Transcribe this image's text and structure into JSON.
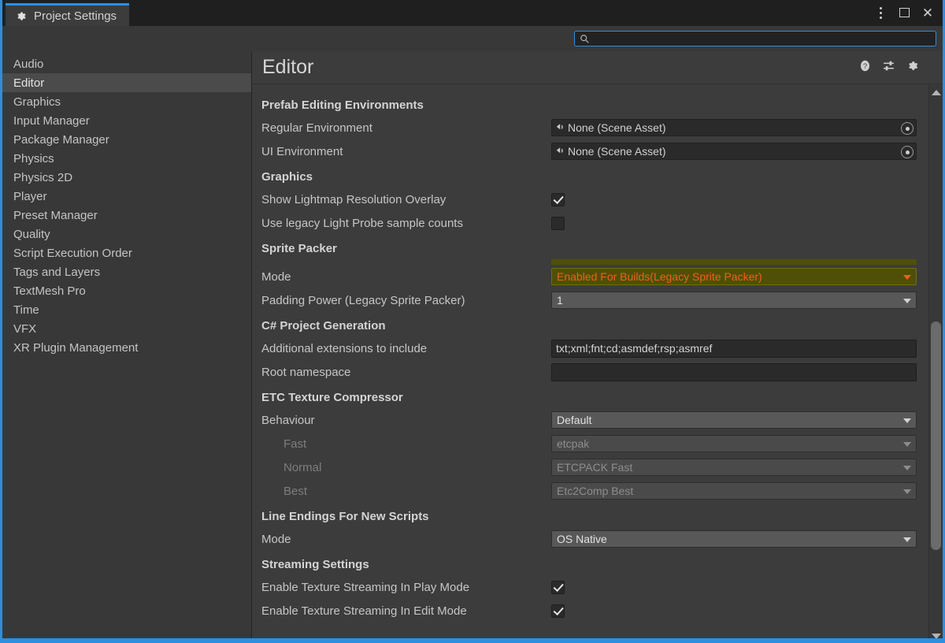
{
  "window": {
    "tab_title": "Project Settings",
    "tab_icon": "gear-icon",
    "controls": {
      "menu": "kebab-menu-icon",
      "maximize": "maximize-icon",
      "close": "close-icon"
    },
    "accent_color": "#2c8fe0"
  },
  "search": {
    "value": "",
    "placeholder": "",
    "icon": "search-icon"
  },
  "sidebar": {
    "items": [
      {
        "label": "Audio",
        "selected": false
      },
      {
        "label": "Editor",
        "selected": true
      },
      {
        "label": "Graphics",
        "selected": false
      },
      {
        "label": "Input Manager",
        "selected": false
      },
      {
        "label": "Package Manager",
        "selected": false
      },
      {
        "label": "Physics",
        "selected": false
      },
      {
        "label": "Physics 2D",
        "selected": false
      },
      {
        "label": "Player",
        "selected": false
      },
      {
        "label": "Preset Manager",
        "selected": false
      },
      {
        "label": "Quality",
        "selected": false
      },
      {
        "label": "Script Execution Order",
        "selected": false
      },
      {
        "label": "Tags and Layers",
        "selected": false
      },
      {
        "label": "TextMesh Pro",
        "selected": false
      },
      {
        "label": "Time",
        "selected": false
      },
      {
        "label": "VFX",
        "selected": false
      },
      {
        "label": "XR Plugin Management",
        "selected": false
      }
    ]
  },
  "panel": {
    "title": "Editor",
    "icons": [
      {
        "name": "help-icon"
      },
      {
        "name": "preset-icon"
      },
      {
        "name": "gear-icon"
      }
    ],
    "sections": [
      {
        "header": "Prefab Editing Environments",
        "rows": [
          {
            "label": "Regular Environment",
            "type": "object",
            "value": "None (Scene Asset)"
          },
          {
            "label": "UI Environment",
            "type": "object",
            "value": "None (Scene Asset)"
          }
        ]
      },
      {
        "header": "Graphics",
        "rows": [
          {
            "label": "Show Lightmap Resolution Overlay",
            "type": "checkbox",
            "checked": true
          },
          {
            "label": "Use legacy Light Probe sample counts",
            "type": "checkbox",
            "checked": false
          }
        ]
      },
      {
        "header": "Sprite Packer",
        "rows": [
          {
            "label": "Mode",
            "type": "dropdown",
            "value": "Enabled For Builds(Legacy Sprite Packer)",
            "highlight": true
          },
          {
            "label": "Padding Power (Legacy Sprite Packer)",
            "type": "dropdown",
            "value": "1"
          }
        ]
      },
      {
        "header": "C# Project Generation",
        "rows": [
          {
            "label": "Additional extensions to include",
            "type": "text",
            "value": "txt;xml;fnt;cd;asmdef;rsp;asmref"
          },
          {
            "label": "Root namespace",
            "type": "text",
            "value": ""
          }
        ]
      },
      {
        "header": "ETC Texture Compressor",
        "rows": [
          {
            "label": "Behaviour",
            "type": "dropdown",
            "value": "Default"
          },
          {
            "label": "Fast",
            "type": "dropdown",
            "value": "etcpak",
            "disabled": true,
            "indent": true
          },
          {
            "label": "Normal",
            "type": "dropdown",
            "value": "ETCPACK Fast",
            "disabled": true,
            "indent": true
          },
          {
            "label": "Best",
            "type": "dropdown",
            "value": "Etc2Comp Best",
            "disabled": true,
            "indent": true
          }
        ]
      },
      {
        "header": "Line Endings For New Scripts",
        "rows": [
          {
            "label": "Mode",
            "type": "dropdown",
            "value": "OS Native"
          }
        ]
      },
      {
        "header": "Streaming Settings",
        "rows": [
          {
            "label": "Enable Texture Streaming In Play Mode",
            "type": "checkbox",
            "checked": true
          },
          {
            "label": "Enable Texture Streaming In Edit Mode",
            "type": "checkbox",
            "checked": true
          }
        ]
      }
    ]
  },
  "scrollbar": {
    "up_arrow": "scroll-up-icon",
    "down_arrow": "scroll-down-icon"
  }
}
